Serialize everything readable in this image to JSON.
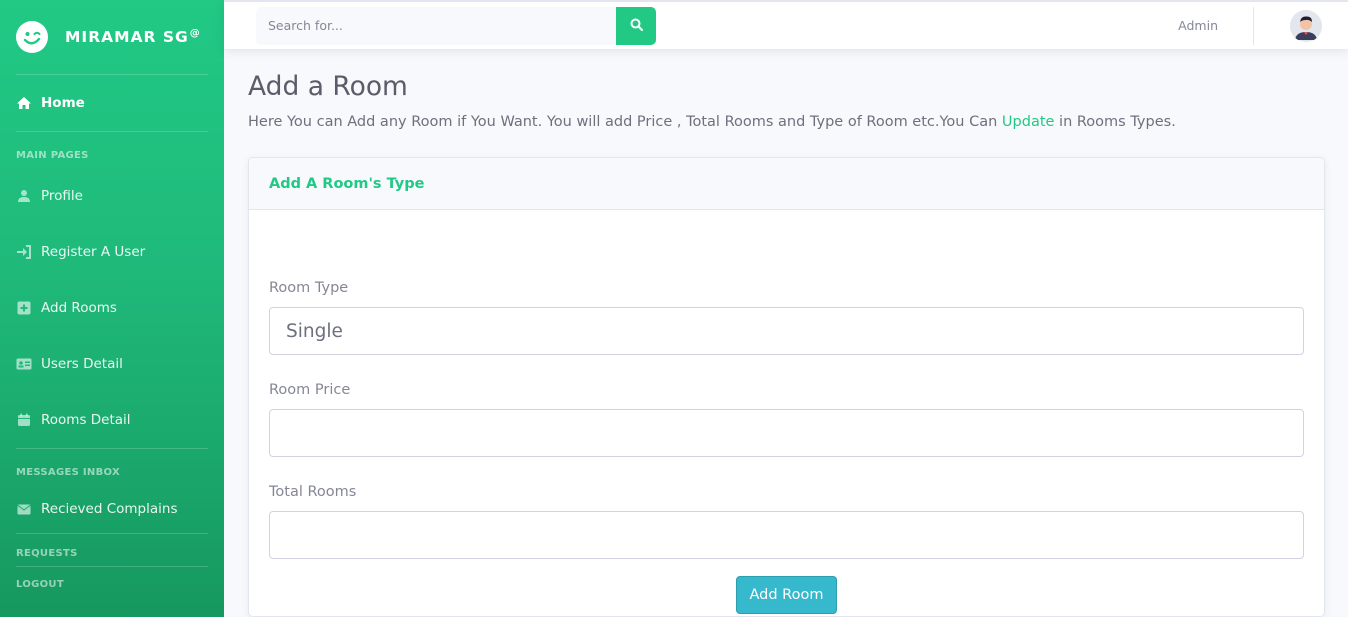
{
  "brand": {
    "name": "MIRAMAR SG",
    "sup": "@"
  },
  "sidebar": {
    "home": "Home",
    "sections": [
      {
        "heading": "MAIN PAGES"
      },
      {
        "heading": "MESSAGES INBOX"
      },
      {
        "heading": "REQUESTS"
      },
      {
        "heading": "LOGOUT"
      }
    ],
    "items": [
      {
        "label": "Profile",
        "icon": "user-icon"
      },
      {
        "label": "Register A User",
        "icon": "sign-in-icon"
      },
      {
        "label": "Add Rooms",
        "icon": "plus-square-icon"
      },
      {
        "label": "Users Detail",
        "icon": "id-card-icon"
      },
      {
        "label": "Rooms Detail",
        "icon": "calendar-icon"
      },
      {
        "label": "Recieved Complains",
        "icon": "envelope-icon"
      }
    ]
  },
  "topbar": {
    "search_placeholder": "Search for...",
    "user_name": "Admin"
  },
  "page": {
    "title": "Add a Room",
    "description_before": "Here You can Add any Room if You Want. You will add Price , Total Rooms and Type of Room etc.You Can ",
    "description_link": "Update",
    "description_after": " in Rooms Types."
  },
  "card": {
    "header": "Add A Room's Type",
    "fields": [
      {
        "label": "Room Type",
        "value": "Single"
      },
      {
        "label": "Room Price",
        "value": ""
      },
      {
        "label": "Total Rooms",
        "value": ""
      }
    ],
    "submit_label": "Add Room"
  },
  "colors": {
    "accent": "#21c985",
    "button": "#36b9cc",
    "sidebar_top": "#21c985",
    "sidebar_bottom": "#16985f"
  }
}
